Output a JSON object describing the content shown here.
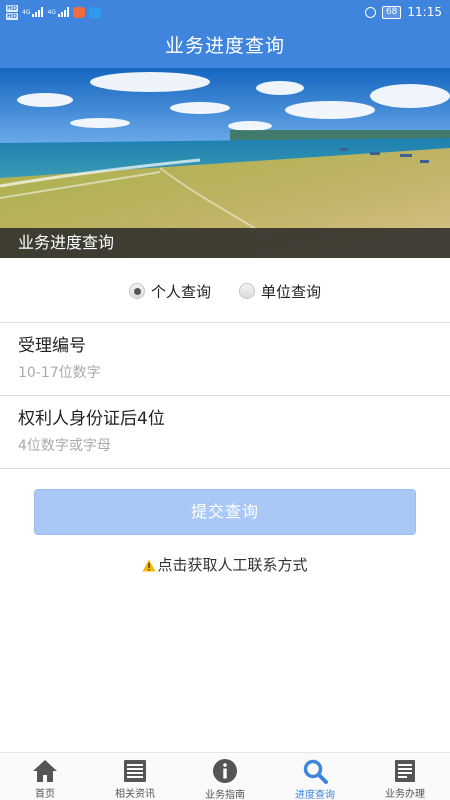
{
  "statusbar": {
    "network_top": "HD",
    "network_bottom": "HD",
    "signal1_label": "4G",
    "signal2_label": "4G",
    "battery": "68",
    "time": "11:15"
  },
  "header": {
    "title": "业务进度查询"
  },
  "banner": {
    "caption": "业务进度查询"
  },
  "query_type": {
    "options": [
      {
        "label": "个人查询",
        "checked": true
      },
      {
        "label": "单位查询",
        "checked": false
      }
    ]
  },
  "form": {
    "acceptance_number": {
      "label": "受理编号",
      "placeholder": "10-17位数字",
      "value": ""
    },
    "id_last4": {
      "label": "权利人身份证后4位",
      "placeholder": "4位数字或字母",
      "value": ""
    },
    "submit_label": "提交查询"
  },
  "contact": {
    "text": "点击获取人工联系方式"
  },
  "bottom_nav": {
    "items": [
      {
        "label": "首页",
        "icon": "home-icon"
      },
      {
        "label": "相关资讯",
        "icon": "news-icon"
      },
      {
        "label": "业务指南",
        "icon": "info-icon"
      },
      {
        "label": "进度查询",
        "icon": "search-icon",
        "active": true
      },
      {
        "label": "业务办理",
        "icon": "document-icon"
      }
    ]
  },
  "colors": {
    "primary": "#3f84dd",
    "submit_disabled": "#a9c8f5",
    "warning": "#f5b800",
    "nav_icon": "#555555"
  }
}
